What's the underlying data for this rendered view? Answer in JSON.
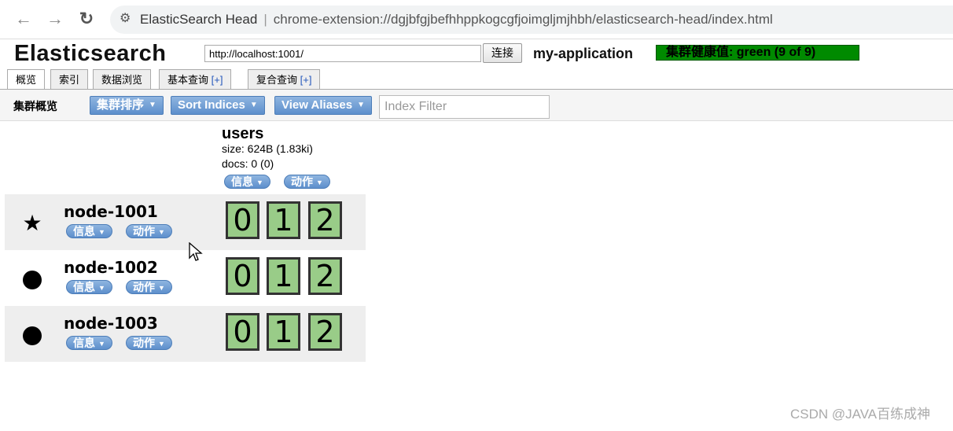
{
  "browser": {
    "tab_title": "ElasticSearch Head",
    "url": "chrome-extension://dgjbfgjbefhhppkogcgfjoimgljmjhbh/elasticsearch-head/index.html",
    "separator": "|"
  },
  "app": {
    "title": "Elasticsearch",
    "connect_url": "http://localhost:1001/",
    "connect_label": "连接",
    "cluster_name": "my-application",
    "health_text": "集群健康值: green (9 of 9)",
    "health_color": "#008a00"
  },
  "tabs": [
    {
      "label": "概览",
      "plus": ""
    },
    {
      "label": "索引",
      "plus": ""
    },
    {
      "label": "数据浏览",
      "plus": ""
    },
    {
      "label": "基本查询 ",
      "plus": "[+]"
    },
    {
      "label": "复合查询 ",
      "plus": "[+]"
    }
  ],
  "toolbar": {
    "overview_label": "集群概览",
    "cluster_sort": "集群排序",
    "sort_indices": "Sort Indices",
    "view_aliases": "View Aliases",
    "index_filter_placeholder": "Index Filter"
  },
  "index": {
    "name": "users",
    "size": "size: 624B (1.83ki)",
    "docs": "docs: 0 (0)",
    "info_label": "信息",
    "action_label": "动作"
  },
  "nodes": [
    {
      "name": "node-1001",
      "master": true,
      "info_label": "信息",
      "action_label": "动作",
      "shards": [
        "0",
        "1",
        "2"
      ]
    },
    {
      "name": "node-1002",
      "master": false,
      "info_label": "信息",
      "action_label": "动作",
      "shards": [
        "0",
        "1",
        "2"
      ]
    },
    {
      "name": "node-1003",
      "master": false,
      "info_label": "信息",
      "action_label": "动作",
      "shards": [
        "0",
        "1",
        "2"
      ]
    }
  ],
  "shard_color": "#99cc88",
  "watermark": "CSDN @JAVA百练成神"
}
